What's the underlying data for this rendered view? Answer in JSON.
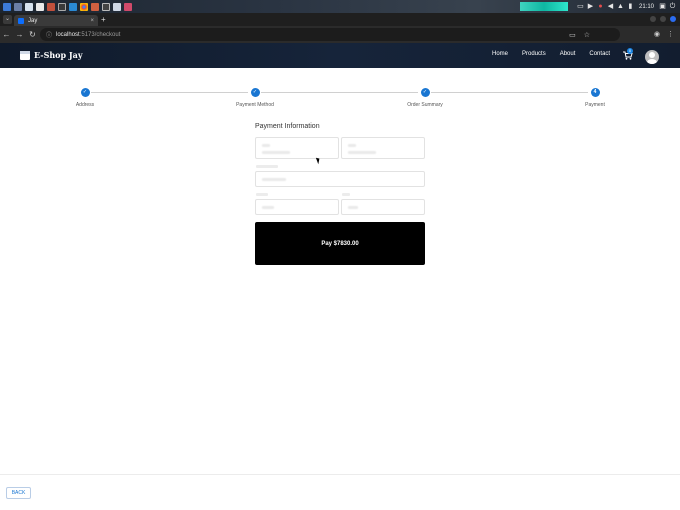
{
  "os": {
    "clock": "21:10",
    "taskbar_icons": [
      "app-menu-icon",
      "desktop-icon",
      "files-icon",
      "editor-icon",
      "app-icon",
      "terminal-icon",
      "vscode-icon",
      "chrome-icon",
      "app-icon",
      "window-icon",
      "notes-icon",
      "app-icon"
    ],
    "status_icons": [
      "window-icon",
      "video-icon",
      "record-icon",
      "volume-icon",
      "bell-icon",
      "battery-icon",
      "lock-icon",
      "power-icon"
    ]
  },
  "browser": {
    "tab_title": "Jay",
    "tab_close": "×",
    "new_tab": "+",
    "url_host": "localhost",
    "url_path": ":5173/checkout"
  },
  "navbar": {
    "brand": "E-Shop Jay",
    "links": [
      "Home",
      "Products",
      "About",
      "Contact"
    ],
    "cart_count": "0"
  },
  "stepper": {
    "steps": [
      {
        "label": "Address",
        "state": "done"
      },
      {
        "label": "Payment Method",
        "state": "done"
      },
      {
        "label": "Order Summary",
        "state": "done"
      },
      {
        "label": "Payment",
        "state": "active",
        "number": "4"
      }
    ],
    "check_glyph": "✓",
    "accent": "#1976d2"
  },
  "payment": {
    "title": "Payment Information",
    "pay_button": "Pay $7830.00"
  },
  "footer": {
    "back_button": "BACK"
  }
}
